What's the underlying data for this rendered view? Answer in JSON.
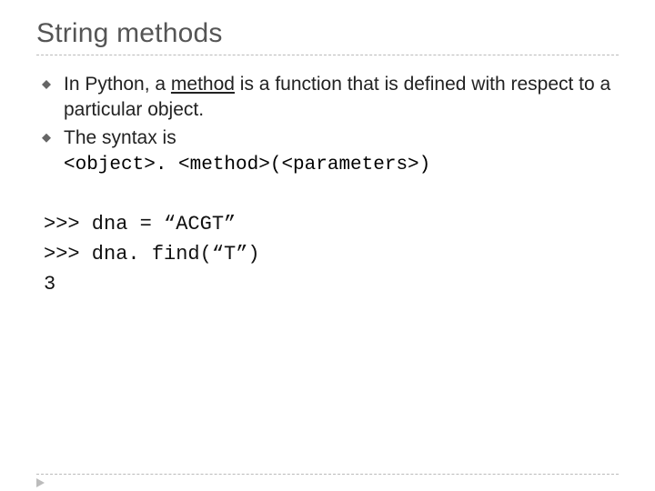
{
  "title": "String methods",
  "bullets": [
    {
      "pre": "In Python, a ",
      "und": "method",
      "post": " is a function that is defined with respect to a particular object."
    },
    {
      "pre": "The syntax is",
      "und": "",
      "post": ""
    }
  ],
  "syntax_line": "<object>. <method>(<parameters>)",
  "code": {
    "line1": ">>> dna = “ACGT”",
    "line2": ">>> dna. find(“T”)",
    "line3": "3"
  }
}
